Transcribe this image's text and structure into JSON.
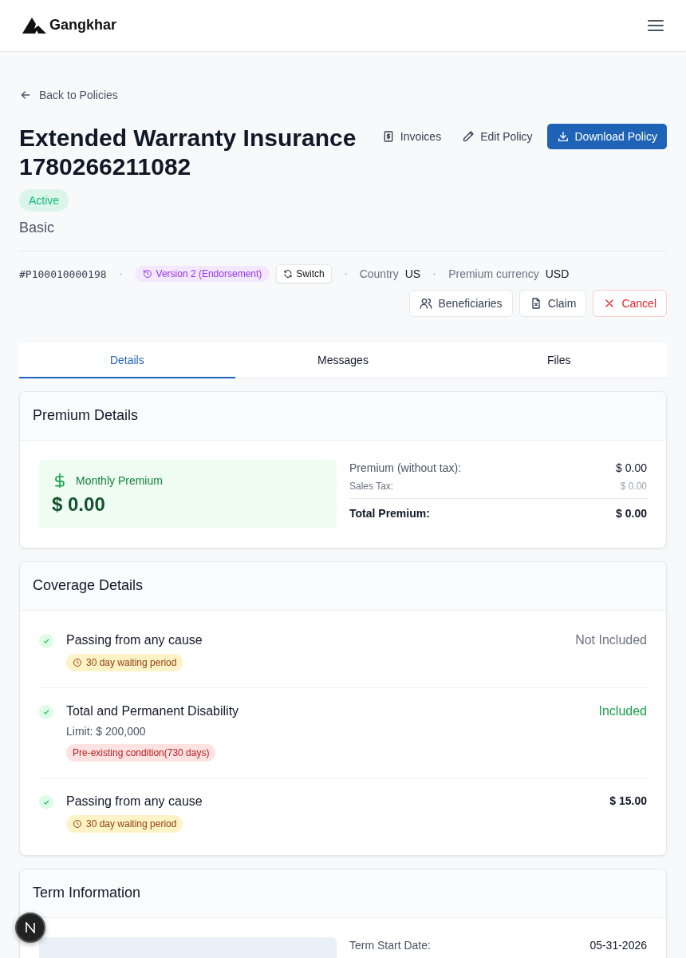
{
  "brand": {
    "name": "Gangkhar"
  },
  "back_link": "Back to Policies",
  "policy": {
    "title": "Extended Warranty Insurance 1780266211082",
    "status": "Active",
    "plan": "Basic",
    "number": "#P100010000198",
    "version": "Version 2 (Endorsement)",
    "switch_label": "Switch",
    "meta": [
      {
        "label": "Country",
        "value": "US"
      },
      {
        "label": "Premium currency",
        "value": "USD"
      }
    ]
  },
  "actions": [
    {
      "label": "Invoices",
      "kind": "invoices"
    },
    {
      "label": "Edit Policy",
      "kind": "edit"
    },
    {
      "label": "Download Policy",
      "kind": "download"
    }
  ],
  "secondary_actions": [
    {
      "label": "Beneficiaries",
      "kind": "beneficiaries"
    },
    {
      "label": "Claim",
      "kind": "claim"
    },
    {
      "label": "Cancel",
      "kind": "cancel"
    }
  ],
  "tabs": [
    {
      "label": "Details",
      "selected": true
    },
    {
      "label": "Messages",
      "selected": false
    },
    {
      "label": "Files",
      "selected": false
    }
  ],
  "premium": {
    "title": "Premium Details",
    "monthly_label": "Monthly Premium",
    "monthly_amount": "$ 0.00",
    "rows": [
      {
        "label": "Premium (without tax):",
        "value": "$ 0.00",
        "kind": "main"
      },
      {
        "label": "Sales Tax:",
        "value": "$ 0.00",
        "kind": "minor"
      },
      {
        "label": "Total Premium:",
        "value": "$ 0.00",
        "kind": "total"
      }
    ]
  },
  "coverage": {
    "title": "Coverage Details",
    "items": [
      {
        "name": "Passing from any cause",
        "value": "Not Included",
        "kind": "excluded",
        "tags": [
          {
            "label": "30 day waiting period",
            "kind": "waiting"
          }
        ]
      },
      {
        "name": "Total and Permanent Disability",
        "limit": "Limit: $ 200,000",
        "value": "Included",
        "kind": "included",
        "tags": [
          {
            "label": "Pre-existing condition(730 days)",
            "kind": "condition"
          }
        ]
      },
      {
        "name": "Passing from any cause",
        "value": "$ 15.00",
        "kind": "amount",
        "tags": [
          {
            "label": "30 day waiting period",
            "kind": "waiting"
          }
        ]
      }
    ]
  },
  "term": {
    "title": "Term Information",
    "rows": [
      {
        "label": "Term Start Date:",
        "value": "05-31-2026"
      }
    ]
  }
}
